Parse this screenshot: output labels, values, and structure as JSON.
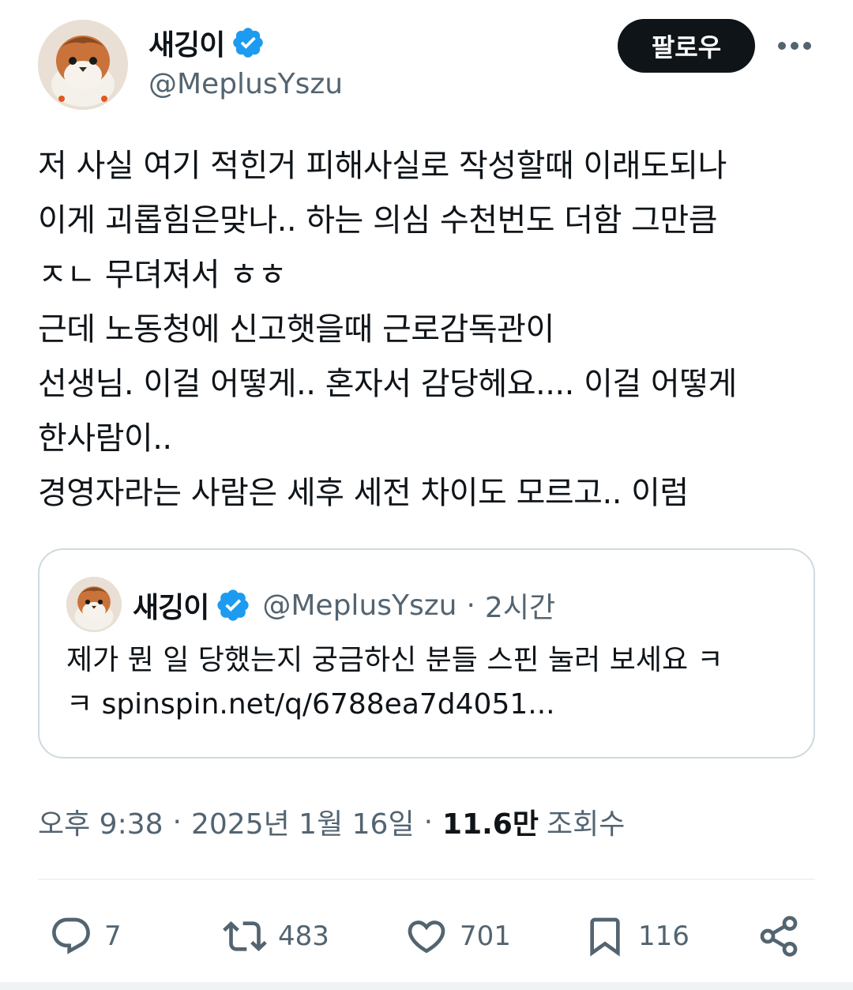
{
  "colors": {
    "text_primary": "#0f1419",
    "text_secondary": "#536471",
    "verified_blue": "#1d9bf0",
    "follow_button_bg": "#0f1419",
    "border": "#cfd9de"
  },
  "author": {
    "display_name": "새깅이",
    "handle": "@MeplusYszu",
    "verified": true,
    "avatar_icon": "plush-bird-avatar"
  },
  "header": {
    "follow_label": "팔로우",
    "more_icon": "more-horizontal-icon"
  },
  "tweet": {
    "lines": [
      "저 사실 여기 적힌거 피해사실로 작성할때 이래도되나",
      "이게 괴롭힘은맞나.. 하는 의심 수천번도 더함 그만큼",
      "ㅈㄴ 무뎌져서 ㅎㅎ",
      "근데 노동청에 신고햇을때 근로감독관이",
      "선생님. 이걸 어떻게.. 혼자서 감당헤요.... 이걸 어떻게",
      "한사람이..",
      "경영자라는 사람은 세후 세전 차이도 모르고.. 이럼"
    ]
  },
  "quote": {
    "display_name": "새깅이",
    "handle": "@MeplusYszu",
    "separator": "·",
    "time": "2시간",
    "lines": [
      "제가 뭔 일 당했는지 궁금하신 분들 스핀 눌러 보세요 ㅋ",
      "ㅋ spinspin.net/q/6788ea7d4051..."
    ]
  },
  "meta": {
    "time": "오후 9:38",
    "separator": "·",
    "date": "2025년 1월 16일",
    "views_count": "11.6만",
    "views_label": "조회수"
  },
  "actions": {
    "reply": {
      "icon": "reply-icon",
      "count": "7"
    },
    "retweet": {
      "icon": "retweet-icon",
      "count": "483"
    },
    "like": {
      "icon": "heart-icon",
      "count": "701"
    },
    "bookmark": {
      "icon": "bookmark-icon",
      "count": "116"
    },
    "share": {
      "icon": "share-icon"
    }
  }
}
